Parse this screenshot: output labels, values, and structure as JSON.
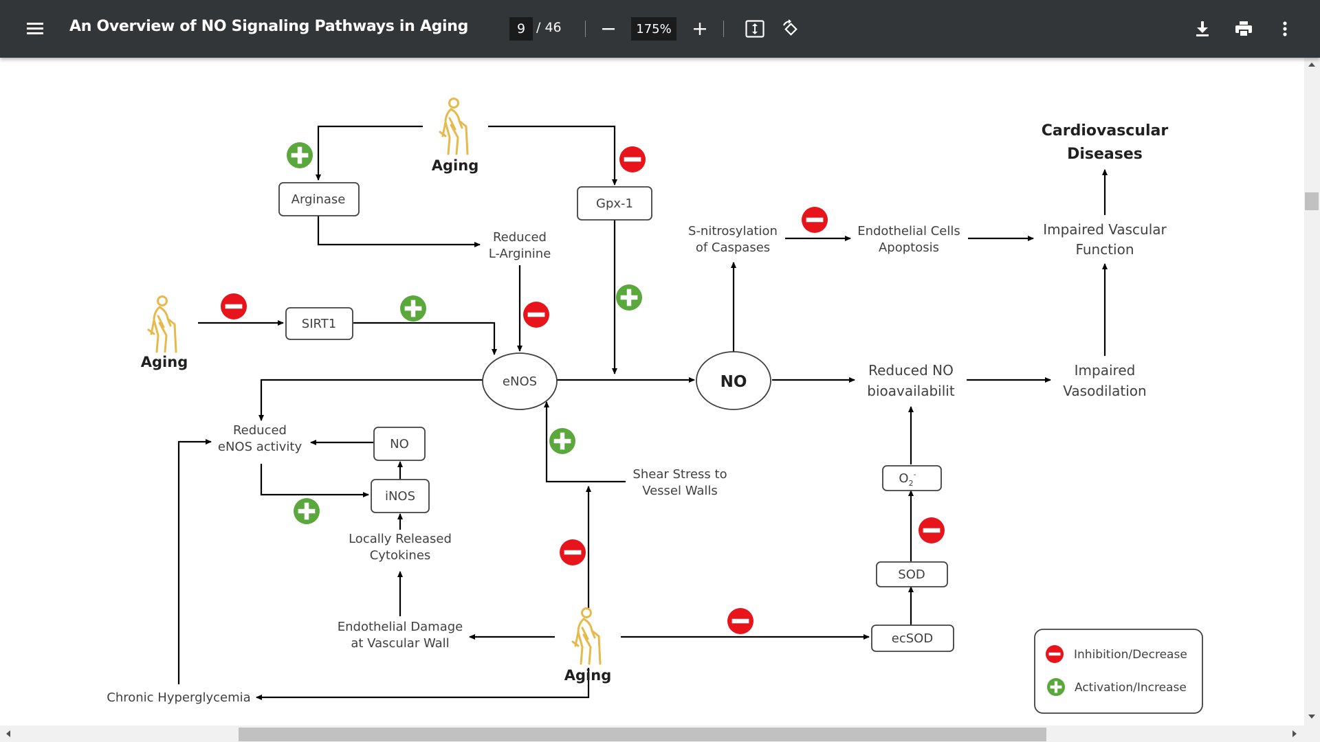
{
  "toolbar": {
    "title": "An Overview of NO Signaling Pathways in Aging",
    "current_page": "9",
    "total_pages": "/ 46",
    "zoom": "175%",
    "icons": [
      "menu-icon",
      "minus-icon",
      "plus-icon",
      "fit-page-icon",
      "rotate-icon",
      "download-icon",
      "print-icon",
      "more-vert-icon"
    ]
  },
  "diagram": {
    "nodes": {
      "aging_top": "Aging",
      "aging_left": "Aging",
      "aging_bottom": "Aging",
      "arginase": "Arginase",
      "gpx1": "Gpx-1",
      "sirt1": "SIRT1",
      "reduced_larginine_1": "Reduced",
      "reduced_larginine_2": "L-Arginine",
      "enos": "eNOS",
      "no_main": "NO",
      "snitro_1": "S-nitrosylation",
      "snitro_2": "of Caspases",
      "endo_apop_1": "Endothelial Cells",
      "endo_apop_2": "Apoptosis",
      "cvd_1": "Cardiovascular",
      "cvd_2": "Diseases",
      "impaired_vf_1": "Impaired Vascular",
      "impaired_vf_2": "Function",
      "reduced_nob_1": "Reduced NO",
      "reduced_nob_2": "bioavailabilit",
      "impaired_vaso_1": "Impaired",
      "impaired_vaso_2": "Vasodilation",
      "reduced_enos_1": "Reduced",
      "reduced_enos_2": "eNOS activity",
      "no_small": "NO",
      "inos": "iNOS",
      "cytokines_1": "Locally Released",
      "cytokines_2": "Cytokines",
      "shear_1": "Shear Stress to",
      "shear_2": "Vessel Walls",
      "o2": "O",
      "o2_sub": "2",
      "o2_sup": "-",
      "sod": "SOD",
      "ecsod": "ecSOD",
      "endo_damage_1": "Endothelial Damage",
      "endo_damage_2": "at Vascular Wall",
      "chronic_hyper": "Chronic Hyperglycemia"
    },
    "legend": {
      "inhibition": "Inhibition/Decrease",
      "activation": "Activation/Increase"
    },
    "colors": {
      "inhibit": "#e8141b",
      "activate": "#5aa83b",
      "figure": "#e6b94a"
    }
  }
}
